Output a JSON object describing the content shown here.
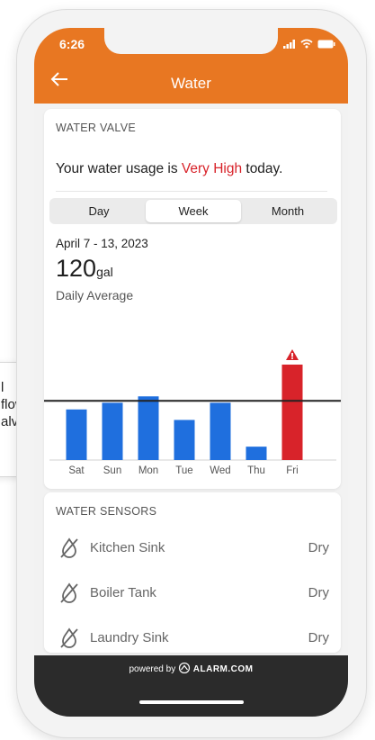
{
  "callout": {
    "text": "l\nflow\nalve"
  },
  "status_bar": {
    "time": "6:26"
  },
  "header": {
    "title": "Water"
  },
  "water_valve": {
    "section_title": "WATER VALVE",
    "usage_prefix": "Your water usage is ",
    "usage_level": "Very High",
    "usage_suffix": " today.",
    "tabs": [
      "Day",
      "Week",
      "Month"
    ],
    "active_tab": "Week",
    "date_range": "April 7 - 13, 2023",
    "average_value": "120",
    "average_unit": "gal",
    "average_label": "Daily Average"
  },
  "chart_data": {
    "type": "bar",
    "categories": [
      "Sat",
      "Sun",
      "Mon",
      "Tue",
      "Wed",
      "Thu",
      "Fri"
    ],
    "values": [
      0.53,
      0.6,
      0.66,
      0.42,
      0.6,
      0.14,
      1.0
    ],
    "average": 0.62,
    "alert_category": "Fri",
    "colors": {
      "normal": "#1f6fde",
      "alert": "#d8232a",
      "average_line": "#222222",
      "mon_marker": "#1f6fde"
    }
  },
  "water_sensors": {
    "section_title": "WATER SENSORS",
    "items": [
      {
        "name": "Kitchen Sink",
        "status": "Dry"
      },
      {
        "name": "Boiler Tank",
        "status": "Dry"
      },
      {
        "name": "Laundry Sink",
        "status": "Dry"
      }
    ]
  },
  "footer": {
    "powered_by": "powered by",
    "brand": "ALARM.COM"
  }
}
